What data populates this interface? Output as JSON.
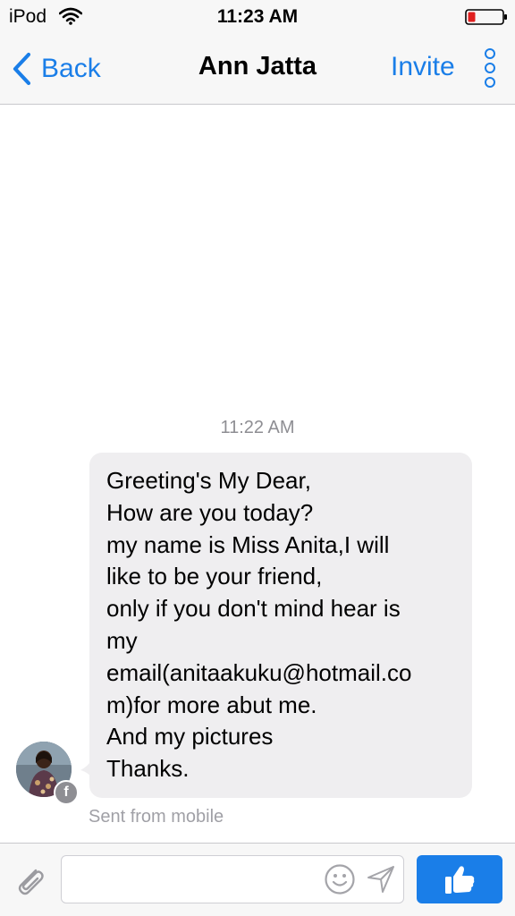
{
  "status_bar": {
    "device": "iPod",
    "time": "11:23 AM",
    "icons": [
      "wifi-icon",
      "battery-icon"
    ],
    "battery_color": "#e02020"
  },
  "nav": {
    "back_label": "Back",
    "title": "Ann Jatta",
    "invite_label": "Invite",
    "icons": [
      "chevron-left-icon",
      "more-vertical-icon"
    ]
  },
  "conversation": {
    "timestamp": "11:22 AM",
    "message": {
      "lines": [
        "Greeting's My Dear,",
        "How are you today?",
        "my name is Miss Anita,I will",
        "like to be your friend,",
        "only if you don't mind hear is",
        "my",
        "email(anitaakuku@hotmail.co",
        "m)for more abut me.",
        "And my pictures",
        "Thanks."
      ]
    },
    "avatar_badge": "f",
    "sent_from": "Sent from mobile"
  },
  "composer": {
    "input_value": "",
    "input_placeholder": "",
    "icons": [
      "paperclip-icon",
      "emoji-icon",
      "send-icon",
      "thumbs-up-icon"
    ]
  },
  "colors": {
    "accent": "#1a7ee8",
    "bubble": "#efeef0",
    "bar_background": "#f7f7f7",
    "secondary_text": "#8e8e93"
  }
}
